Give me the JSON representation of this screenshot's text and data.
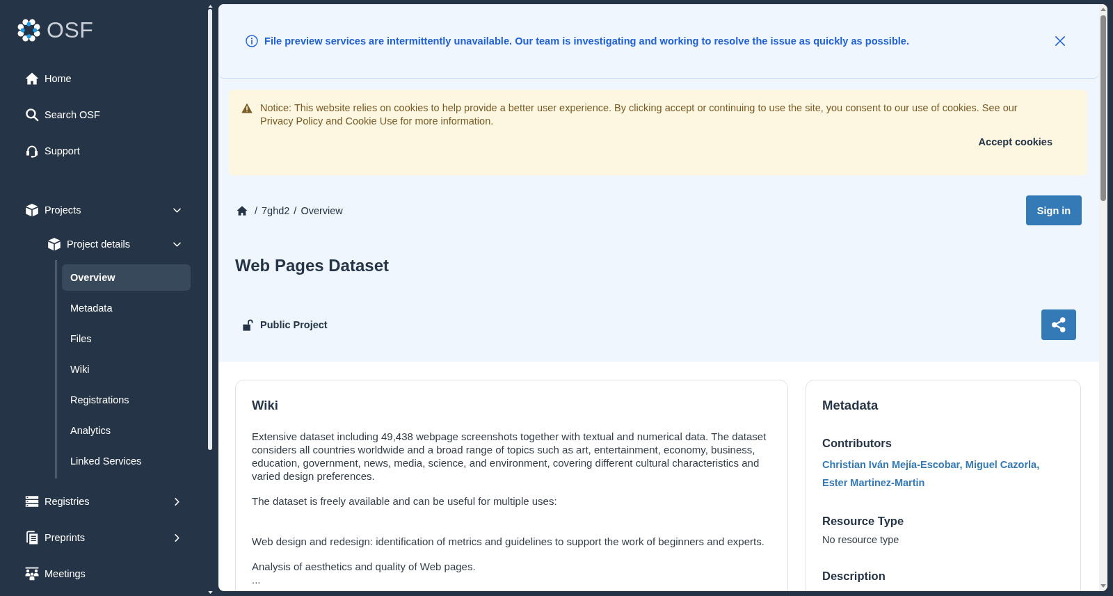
{
  "sidebar": {
    "logo_text": "OSF",
    "primary_items": [
      {
        "kind": "link",
        "label": "Home"
      },
      {
        "kind": "link",
        "label": "Search OSF"
      },
      {
        "kind": "link",
        "label": "Support"
      }
    ],
    "secondary_items": [
      {
        "kind": "group",
        "label": "Projects",
        "expanded": true,
        "children": [
          {
            "kind": "group",
            "label": "Project details",
            "expanded": true,
            "children": [
              {
                "label": "Overview",
                "selected": true
              },
              {
                "label": "Metadata",
                "selected": false
              },
              {
                "label": "Files",
                "selected": false
              },
              {
                "label": "Wiki",
                "selected": false
              },
              {
                "label": "Registrations",
                "selected": false
              },
              {
                "label": "Analytics",
                "selected": false
              },
              {
                "label": "Linked Services",
                "selected": false
              }
            ]
          }
        ]
      },
      {
        "kind": "group",
        "label": "Registries",
        "expanded": false
      },
      {
        "kind": "group",
        "label": "Preprints",
        "expanded": false
      },
      {
        "kind": "link",
        "label": "Meetings"
      }
    ]
  },
  "alert": {
    "text": "File preview services are intermittently unavailable. Our team is investigating and working to resolve the issue as quickly as possible."
  },
  "cookie_notice": {
    "text": "Notice: This website relies on cookies to help provide a better user experience. By clicking accept or continuing to use the site, you consent to our use of cookies. See our Privacy Policy and Cookie Use for more information.",
    "button": "Accept cookies"
  },
  "breadcrumb": {
    "separator": "/",
    "items": [
      "7ghd2",
      "Overview"
    ]
  },
  "sign_in_button": "Sign in",
  "title": "Web Pages Dataset",
  "visibility": {
    "label": "Public Project",
    "public": true
  },
  "wiki": {
    "title": "Wiki",
    "paragraphs": [
      "Extensive dataset including 49,438 webpage screenshots together with textual and numerical data. The dataset considers all countries worldwide and a broad range of topics such as art, entertainment, economy, business, education, government, news, media, science, and environment, covering different cultural characteristics and varied design preferences.",
      "The dataset is freely available and can be useful for multiple uses:"
    ],
    "uses": [
      "Web design and redesign: identification of metrics and guidelines to support the work of beginners and experts.",
      "Analysis of aesthetics and quality of Web pages."
    ],
    "more": "..."
  },
  "metadata": {
    "title": "Metadata",
    "sections": [
      {
        "kind": "contributors",
        "heading": "Contributors",
        "separator": ",",
        "names": [
          "Christian Iván Mejía-Escobar",
          "Miguel Cazorla",
          "Ester Martinez-Martin"
        ]
      },
      {
        "kind": "text",
        "heading": "Resource Type",
        "value": "No resource type"
      },
      {
        "kind": "text",
        "heading": "Description"
      }
    ]
  }
}
